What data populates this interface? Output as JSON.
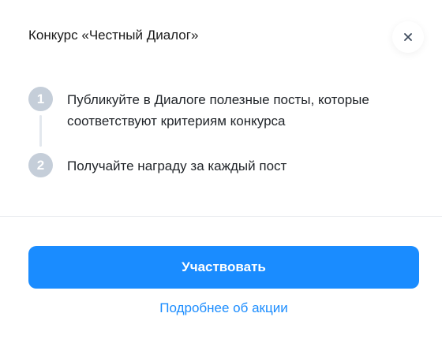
{
  "dialog": {
    "title": "Конкурс «Честный Диалог»",
    "close_icon": "close-icon"
  },
  "steps": [
    {
      "number": "1",
      "text": "Публикуйте в Диалоге полезные посты, которые соответствуют критериям конкурса"
    },
    {
      "number": "2",
      "text": "Получайте награду за каждый пост"
    }
  ],
  "actions": {
    "participate_label": "Участвовать",
    "more_label": "Подробнее об акции"
  },
  "colors": {
    "accent": "#1a8cff",
    "step_badge": "#c5ced9"
  }
}
